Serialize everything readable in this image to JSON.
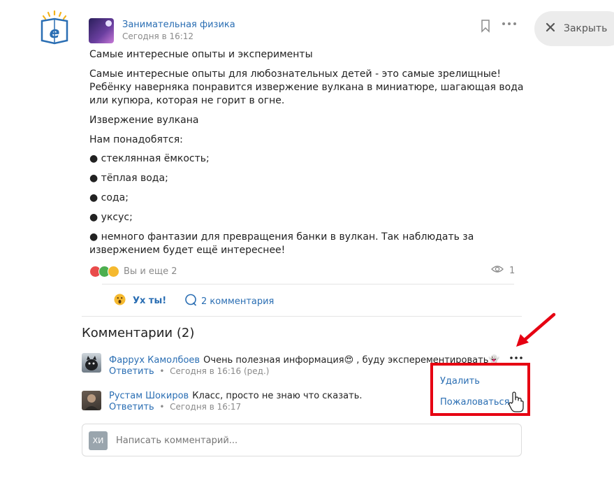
{
  "post": {
    "group_name": "Занимательная физика",
    "time": "Сегодня в 16:12",
    "title": "Самые интересные опыты и эксперименты",
    "paragraph1": [
      "Самые интересные опыты для любознательных детей - это самые зрелищные!",
      "Ребёнку наверняка понравится извержение вулкана в миниатюре, шагающая вода",
      "или купюра, которая не горит в огне."
    ],
    "subtitle": "Извержение вулкана",
    "need": "Нам понадобятся:",
    "items": [
      "● стеклянная ёмкость;",
      "● тёплая вода;",
      "● сода;",
      "● уксус;"
    ],
    "last": [
      "● немного фантазии для превращения банки в вулкан. Так наблюдать за",
      "извержением будет ещё интереснее!"
    ],
    "reactions_text": "Вы и еще 2",
    "views": "1",
    "like_label": "Ух ты!",
    "comments_label": "2 комментария"
  },
  "close_label": "Закрыть",
  "comments": {
    "title": "Комментарии (2)",
    "list": [
      {
        "author": "Фаррух Камолбоев",
        "text": "Очень полезная информация😍 , буду эксперементировать👻",
        "reply": "Ответить",
        "meta": "Сегодня в 16:16 (ред.)"
      },
      {
        "author": "Рустам Шокиров",
        "text": "Класс, просто не знаю что сказать.",
        "reply": "Ответить",
        "meta": "Сегодня в 16:17"
      }
    ]
  },
  "menu": {
    "delete": "Удалить",
    "report": "Пожаловаться"
  },
  "input": {
    "user_initials": "ХИ",
    "placeholder": "Написать комментарий..."
  },
  "colors": {
    "link": "#2a6eb3",
    "highlight": "#e60012",
    "close_bg": "#ececec"
  }
}
